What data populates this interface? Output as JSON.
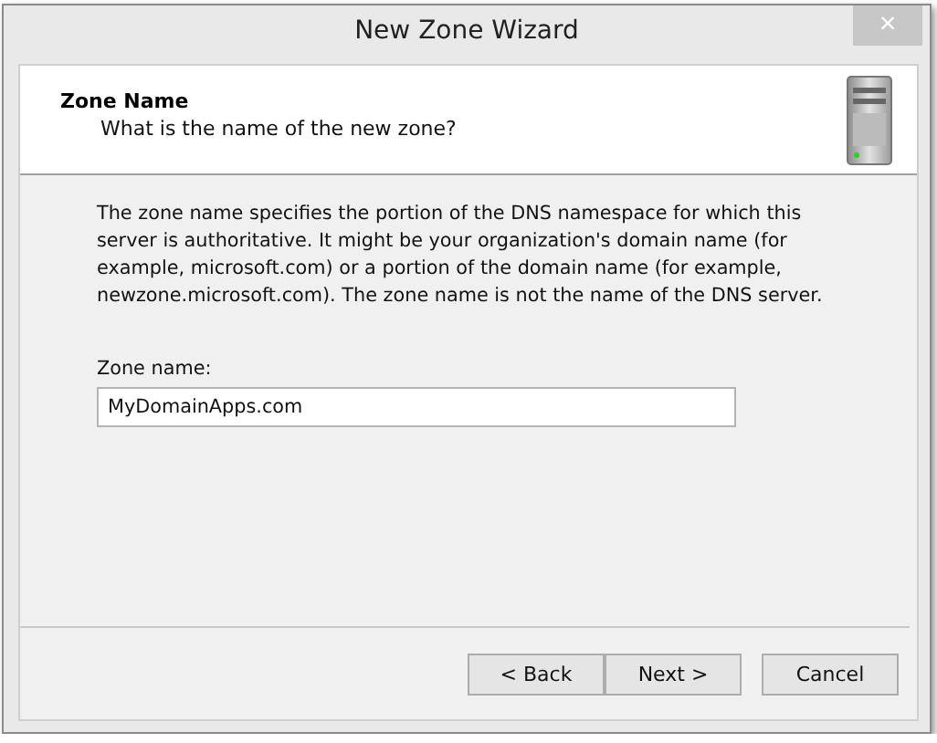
{
  "window": {
    "title": "New Zone Wizard",
    "close": "×"
  },
  "header": {
    "title": "Zone Name",
    "subtitle": "What is the name of the new zone?"
  },
  "description": "The zone name specifies the portion of the DNS namespace for which this server is authoritative. It might be your organization's domain name (for example,  microsoft.com) or a portion of the domain name (for example, newzone.microsoft.com). The zone name is not the name of the DNS server.",
  "zone_name": {
    "label": "Zone name:",
    "value": "MyDomainApps.com"
  },
  "buttons": [
    {
      "label": "< Back",
      "kind": "nav"
    },
    {
      "label": "Next >",
      "kind": "nav"
    },
    {
      "label": "Cancel",
      "kind": "cancel"
    }
  ]
}
